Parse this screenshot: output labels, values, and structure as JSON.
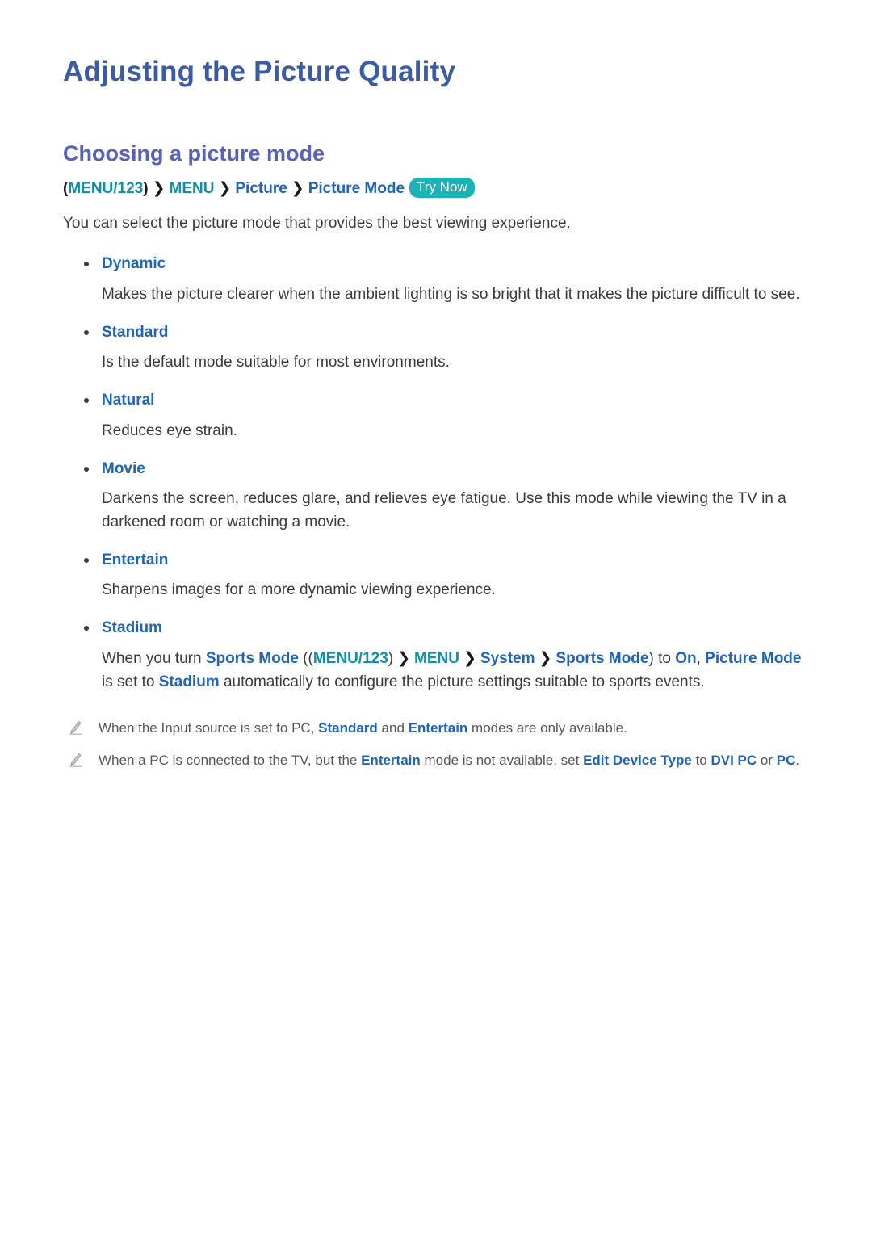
{
  "page": {
    "title": "Adjusting the Picture Quality",
    "section_title": "Choosing a picture mode"
  },
  "menu_path": {
    "open_paren": "(",
    "item1": "MENU/123",
    "close_paren": ")",
    "chevron": "❯",
    "item2": "MENU",
    "item3": "Picture",
    "item4": "Picture Mode",
    "badge": "Try Now"
  },
  "intro": "You can select the picture mode that provides the best viewing experience.",
  "modes": [
    {
      "label": "Dynamic",
      "desc": "Makes the picture clearer when the ambient lighting is so bright that it makes the picture difficult to see."
    },
    {
      "label": "Standard",
      "desc": "Is the default mode suitable for most environments."
    },
    {
      "label": "Natural",
      "desc": "Reduces eye strain."
    },
    {
      "label": "Movie",
      "desc": "Darkens the screen, reduces glare, and relieves eye fatigue. Use this mode while viewing the TV in a darkened room or watching a movie."
    },
    {
      "label": "Entertain",
      "desc": "Sharpens images for a more dynamic viewing experience."
    },
    {
      "label": "Stadium",
      "desc": ""
    }
  ],
  "stadium_desc": {
    "t1": "When you turn ",
    "sports_mode_1": "Sports Mode",
    "t2": " ((",
    "menu123": "MENU/123",
    "chev": "❯",
    "menu": "MENU",
    "system": "System",
    "sports_mode_2": "Sports Mode",
    "t3": ") to ",
    "on": "On",
    "t4": ", ",
    "picture_mode": "Picture Mode",
    "t5": " is set to ",
    "stadium": "Stadium",
    "t6": " automatically to configure the picture settings suitable to sports events."
  },
  "notes": [
    {
      "icon": "pencil-icon",
      "t1": "When the Input source is set to PC, ",
      "b1": "Standard",
      "t2": " and ",
      "b2": "Entertain",
      "t3": " modes are only available."
    },
    {
      "icon": "pencil-icon",
      "t1": "When a PC is connected to the TV, but the ",
      "b1": "Entertain",
      "t2": " mode is not available, set ",
      "b2": "Edit Device Type",
      "t3": " to ",
      "b3": "DVI PC",
      "t4": " or ",
      "b4": "PC",
      "t5": "."
    }
  ],
  "colors": {
    "title_blue": "#3b5ca4",
    "section_purple": "#5762b8",
    "link_blue": "#1f64b5",
    "menu_teal": "#0f8fa8",
    "badge_teal": "#19b3b8",
    "body_gray": "#3b3b3b",
    "note_gray": "#585858"
  }
}
